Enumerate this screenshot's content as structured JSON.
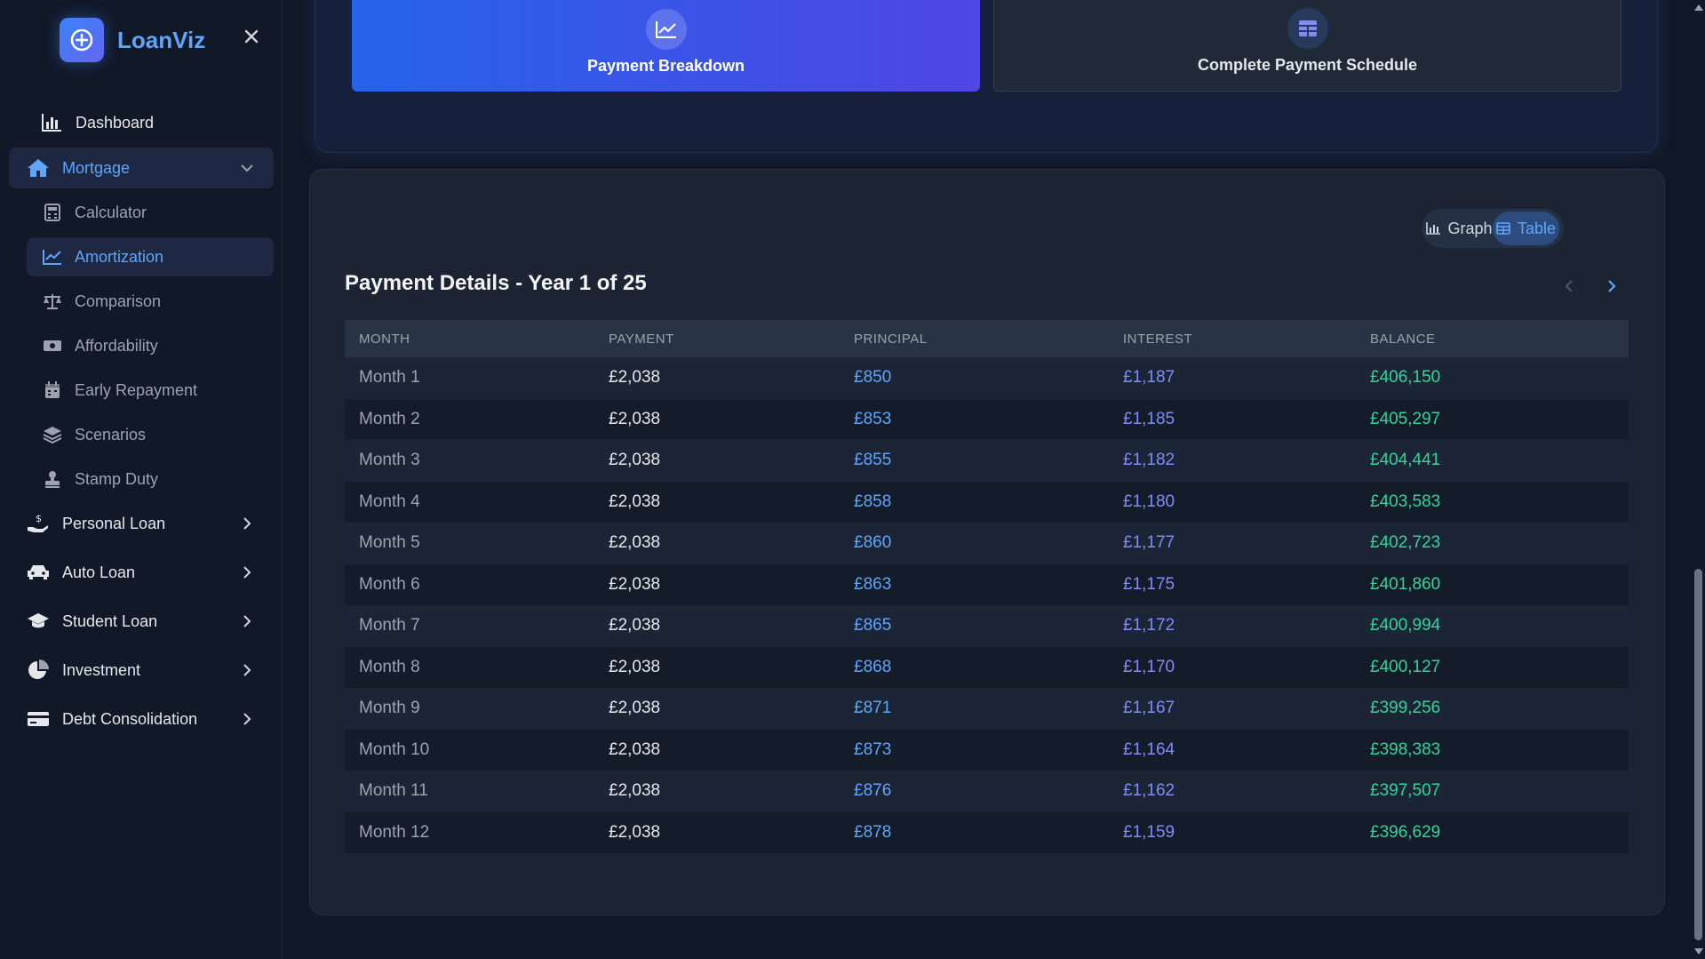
{
  "brand": {
    "name": "LoanViz"
  },
  "sidebar": {
    "dashboard": "Dashboard",
    "mortgage": "Mortgage",
    "sub_items": [
      "Calculator",
      "Amortization",
      "Comparison",
      "Affordability",
      "Early Repayment",
      "Scenarios",
      "Stamp Duty"
    ],
    "groups": [
      "Personal Loan",
      "Auto Loan",
      "Student Loan",
      "Investment",
      "Debt Consolidation"
    ]
  },
  "modes": {
    "breakdown": "Payment Breakdown",
    "schedule": "Complete Payment Schedule"
  },
  "view_toggle": {
    "graph": "Graph",
    "table": "Table"
  },
  "section": {
    "title": "Payment Details - Year 1 of 25"
  },
  "table": {
    "headers": [
      "MONTH",
      "PAYMENT",
      "PRINCIPAL",
      "INTEREST",
      "BALANCE"
    ],
    "rows": [
      [
        "Month 1",
        "£2,038",
        "£850",
        "£1,187",
        "£406,150"
      ],
      [
        "Month 2",
        "£2,038",
        "£853",
        "£1,185",
        "£405,297"
      ],
      [
        "Month 3",
        "£2,038",
        "£855",
        "£1,182",
        "£404,441"
      ],
      [
        "Month 4",
        "£2,038",
        "£858",
        "£1,180",
        "£403,583"
      ],
      [
        "Month 5",
        "£2,038",
        "£860",
        "£1,177",
        "£402,723"
      ],
      [
        "Month 6",
        "£2,038",
        "£863",
        "£1,175",
        "£401,860"
      ],
      [
        "Month 7",
        "£2,038",
        "£865",
        "£1,172",
        "£400,994"
      ],
      [
        "Month 8",
        "£2,038",
        "£868",
        "£1,170",
        "£400,127"
      ],
      [
        "Month 9",
        "£2,038",
        "£871",
        "£1,167",
        "£399,256"
      ],
      [
        "Month 10",
        "£2,038",
        "£873",
        "£1,164",
        "£398,383"
      ],
      [
        "Month 11",
        "£2,038",
        "£876",
        "£1,162",
        "£397,507"
      ],
      [
        "Month 12",
        "£2,038",
        "£878",
        "£1,159",
        "£396,629"
      ]
    ]
  },
  "colors": {
    "accent": "#3b82f6",
    "principal": "#60a5fa",
    "interest": "#818cf8",
    "balance": "#34d399",
    "background": "#111827"
  }
}
